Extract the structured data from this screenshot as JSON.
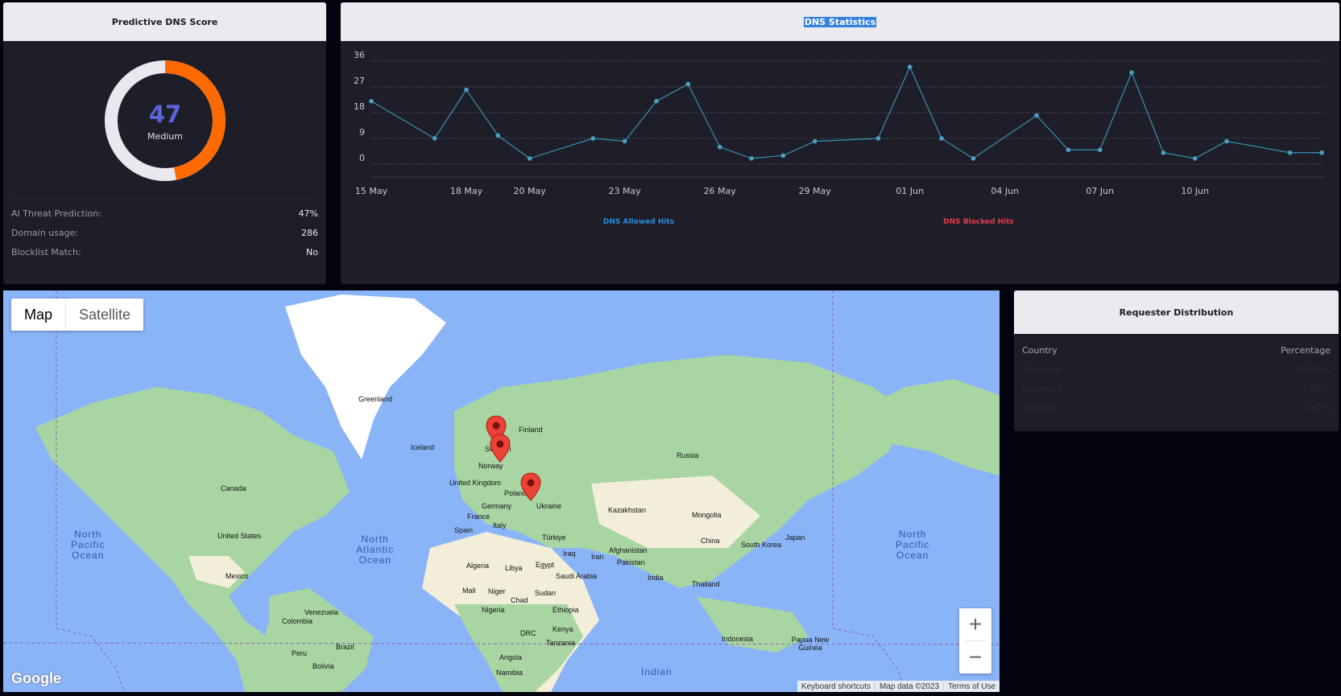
{
  "score_card": {
    "title": "Predictive DNS Score",
    "score": 47,
    "score_display": "47",
    "level": "Medium",
    "colors": {
      "accent": "#ff6a00",
      "track": "#e8e8ee",
      "value": "#5b63d8"
    },
    "stats": [
      {
        "label": "AI Threat Prediction:",
        "value": "47%"
      },
      {
        "label": "Domain usage:",
        "value": "286"
      },
      {
        "label": "Blocklist Match:",
        "value": "No"
      }
    ]
  },
  "stats_card": {
    "title": "DNS Statistics"
  },
  "chart_data": {
    "type": "line",
    "title": "DNS Statistics",
    "xlabel": "",
    "ylabel": "",
    "ylim": [
      0,
      36
    ],
    "yticks": [
      "36",
      "27",
      "18",
      "9",
      "0"
    ],
    "xtick_labels": [
      "15 May",
      "18 May",
      "20 May",
      "23 May",
      "26 May",
      "29 May",
      "01 Jun",
      "04 Jun",
      "07 Jun",
      "10 Jun"
    ],
    "grid": true,
    "legend_position": "bottom",
    "x": [
      "15 May",
      "17 May",
      "18 May",
      "19 May",
      "20 May",
      "22 May",
      "23 May",
      "24 May",
      "25 May",
      "26 May",
      "27 May",
      "28 May",
      "29 May",
      "31 May",
      "01 Jun",
      "02 Jun",
      "03 Jun",
      "05 Jun",
      "06 Jun",
      "07 Jun",
      "08 Jun",
      "09 Jun",
      "10 Jun",
      "11 Jun",
      "13 Jun",
      "14 Jun"
    ],
    "series": [
      {
        "name": "DNS Allowed Hits",
        "color": "#2b8bd6",
        "values": [
          22,
          9,
          26,
          10,
          2,
          9,
          8,
          22,
          28,
          6,
          2,
          3,
          8,
          9,
          34,
          9,
          2,
          17,
          5,
          5,
          32,
          4,
          2,
          8,
          4,
          4
        ]
      },
      {
        "name": "DNS Blocked Hits",
        "color": "#e23b4e",
        "values": []
      }
    ]
  },
  "map": {
    "toggle": {
      "map_label": "Map",
      "satellite_label": "Satellite"
    },
    "zoom": {
      "in_label": "+",
      "out_label": "−"
    },
    "logo": "Google",
    "footer": {
      "shortcuts": "Keyboard shortcuts",
      "data": "Map data ©2023",
      "terms": "Terms of Use"
    },
    "place_labels": [
      "Greenland",
      "Iceland",
      "Finland",
      "Sweden",
      "Norway",
      "United Kingdom",
      "Poland",
      "Germany",
      "Ukraine",
      "France",
      "Spain",
      "Italy",
      "Türkiye",
      "Kazakhstan",
      "Mongolia",
      "Russia",
      "Canada",
      "United States",
      "Mexico",
      "North Pacific Ocean",
      "North Atlantic Ocean",
      "China",
      "Japan",
      "South Korea",
      "Afghanistan",
      "Iraq",
      "Iran",
      "Pakistan",
      "India",
      "Thailand",
      "Algeria",
      "Libya",
      "Egypt",
      "Saudi Arabia",
      "Mali",
      "Niger",
      "Sudan",
      "Chad",
      "Nigeria",
      "Ethiopia",
      "Kenya",
      "DRC",
      "Tanzania",
      "Angola",
      "Namibia",
      "Venezuela",
      "Colombia",
      "Brazil",
      "Peru",
      "Bolivia",
      "Indonesia",
      "Papua New Guinea",
      "Indian"
    ],
    "markers": [
      "Norway",
      "Denmark",
      "Romania"
    ]
  },
  "distribution": {
    "title": "Requester Distribution",
    "col_country": "Country",
    "col_percentage": "Percentage",
    "rows": [
      {
        "country": "Romania",
        "percentage": "88.05%"
      },
      {
        "country": "Denmark",
        "percentage": "7.08%"
      },
      {
        "country": "Norway",
        "percentage": "4.87%"
      }
    ]
  }
}
